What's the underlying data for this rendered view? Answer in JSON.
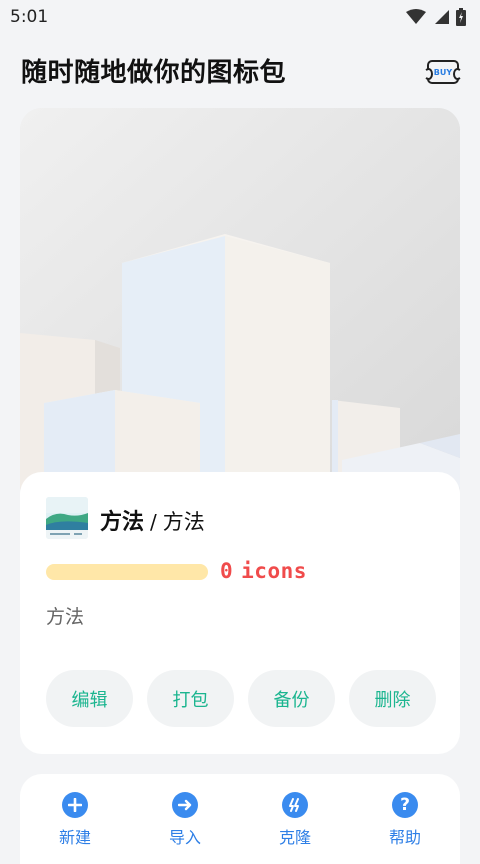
{
  "status_bar": {
    "time": "5:01"
  },
  "header": {
    "title": "随时随地做你的图标包",
    "buy_label": "BUY"
  },
  "pack": {
    "name": "方法",
    "separator": "/",
    "subtitle": "方法",
    "icon_count": "0",
    "icon_unit": "icons",
    "progress_percent": 0,
    "description": "方法"
  },
  "actions": [
    "编辑",
    "打包",
    "备份",
    "删除"
  ],
  "bottom_nav": [
    {
      "label": "新建",
      "icon": "plus-icon"
    },
    {
      "label": "导入",
      "icon": "arrow-right-icon"
    },
    {
      "label": "克隆",
      "icon": "bolt-icon"
    },
    {
      "label": "帮助",
      "icon": "help-icon"
    }
  ],
  "colors": {
    "accent_green": "#1bb58f",
    "accent_blue": "#3a8bef",
    "count_red": "#f04b4b",
    "progress_track": "#ffe7a8"
  }
}
